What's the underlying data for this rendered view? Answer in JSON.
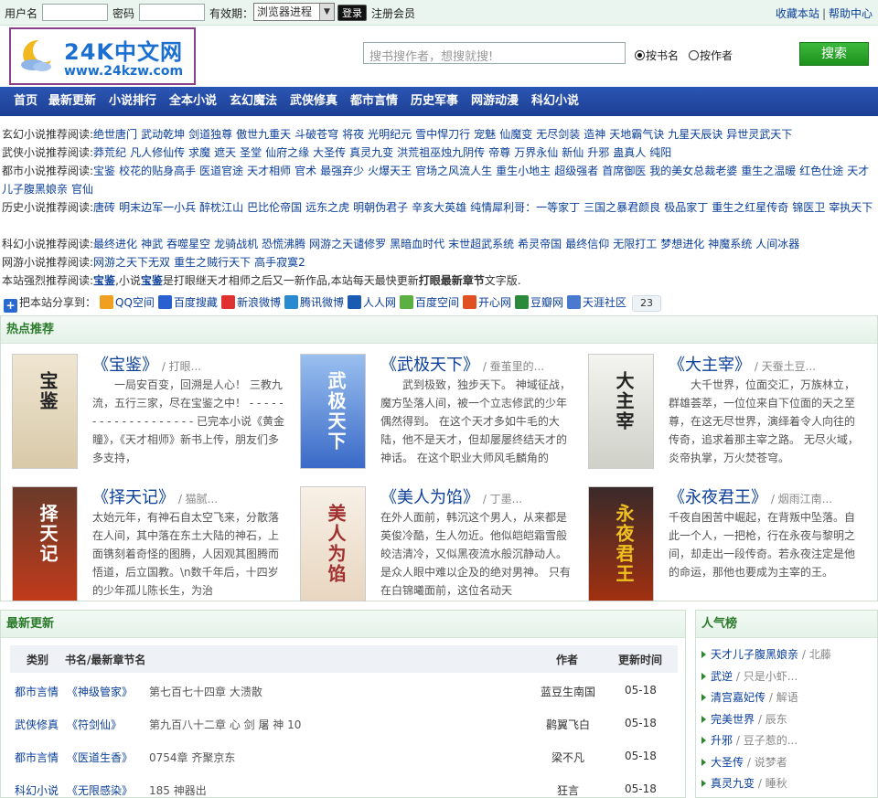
{
  "topbar": {
    "username_label": "用户名",
    "password_label": "密码",
    "validity_label": "有效期：",
    "validity_value": "浏览器进程",
    "login_label": "登录",
    "register_label": "注册会员",
    "bookmark_label": "收藏本站",
    "separator": "|",
    "help_label": "帮助中心"
  },
  "header": {
    "logo_title": "24K中文网",
    "logo_url": "www.24kzw.com",
    "search_placeholder": "搜书搜作者，想搜就搜!",
    "radio_title": "按书名",
    "radio_author": "按作者",
    "search_button": "搜索"
  },
  "nav": [
    "首页",
    "最新更新",
    "小说排行",
    "全本小说",
    "玄幻魔法",
    "武侠修真",
    "都市言情",
    "历史军事",
    "网游动漫",
    "科幻小说"
  ],
  "reco": {
    "rows": [
      {
        "cat": "玄幻小说推荐阅读:",
        "items": [
          "绝世唐门",
          "武动乾坤",
          "剑道独尊",
          "傲世九重天",
          "斗破苍穹",
          "将夜",
          "光明纪元",
          "雪中悍刀行",
          "宠魅",
          "仙魔变",
          "无尽剑装",
          "造神",
          "天地霸气诀",
          "九星天辰诀",
          "异世灵武天下"
        ]
      },
      {
        "cat": "武侠小说推荐阅读:",
        "items": [
          "莽荒纪",
          "凡人修仙传",
          "求魔",
          "遮天",
          "圣堂",
          "仙府之缘",
          "大圣传",
          "真灵九变",
          "洪荒祖巫烛九阴传",
          "帝尊",
          "万界永仙",
          "新仙",
          "升邪",
          "蛊真人",
          "纯阳"
        ]
      },
      {
        "cat": "都市小说推荐阅读:",
        "items": [
          "宝鉴",
          "校花的贴身高手",
          "医道官途",
          "天才相师",
          "官术",
          "最强弃少",
          "火爆天王",
          "官场之风流人生",
          "重生小地主",
          "超级强者",
          "首席御医",
          "我的美女总裁老婆",
          "重生之温暖",
          "红色仕途",
          "天才儿子腹黑娘亲",
          "官仙"
        ]
      },
      {
        "cat": "历史小说推荐阅读:",
        "items": [
          "唐砖",
          "明末边军一小兵",
          "醉枕江山",
          "巴比伦帝国",
          "远东之虎",
          "明朝伪君子",
          "辛亥大英雄",
          "纯情犀利哥：一等家丁",
          "三国之暴君颜良",
          "极品家丁",
          "重生之红星传奇",
          "锦医卫",
          "宰执天下"
        ]
      },
      {
        "cat": "",
        "items": []
      },
      {
        "cat": "科幻小说推荐阅读:",
        "items": [
          "最终进化",
          "神武",
          "吞噬星空",
          "龙骑战机",
          "恐慌沸腾",
          "网游之天谴修罗",
          "黑暗血时代",
          "末世超武系统",
          "希灵帝国",
          "最终信仰",
          "无限打工",
          "梦想进化",
          "神魔系统",
          "人间冰器"
        ]
      },
      {
        "cat": "网游小说推荐阅读:",
        "items": [
          "网游之天下无双",
          "重生之贼行天下",
          "高手寂寞2"
        ]
      }
    ],
    "strong_prefix": "本站强烈推荐阅读:",
    "strong_book": "宝鉴",
    "strong_mid1": ",小说",
    "strong_book2": "宝鉴",
    "strong_mid2": "是打眼继天才相师之后又一新作品,本站每天最快更新",
    "strong_bold": "打眼最新章节",
    "strong_tail": "文字版."
  },
  "share": {
    "label": "把本站分享到：",
    "targets": [
      {
        "name": "QQ空间",
        "color": "#f0a020"
      },
      {
        "name": "百度搜藏",
        "color": "#2a5fd0"
      },
      {
        "name": "新浪微博",
        "color": "#e03030"
      },
      {
        "name": "腾讯微博",
        "color": "#2a8ad0"
      },
      {
        "name": "人人网",
        "color": "#1a5ab0"
      },
      {
        "name": "百度空间",
        "color": "#5ab040"
      },
      {
        "name": "开心网",
        "color": "#e05020"
      },
      {
        "name": "豆瓣网",
        "color": "#2a8a3a"
      },
      {
        "name": "天涯社区",
        "color": "#4a7ad0"
      }
    ],
    "count": "23"
  },
  "hot": {
    "title": "热点推荐",
    "books": [
      {
        "title": "《宝鉴》",
        "author": " / 打眼...",
        "desc": "　　一局安百变，回溯是人心！ 三教九流，五行三家，尽在宝鉴之中！ - - - - - - - - - - - - - - - - - - - 已完本小说《黄金瞳》，《天才相师》新书上传，朋友们多多支持，",
        "cover_text": "宝鉴"
      },
      {
        "title": "《武极天下》",
        "author": " / 蚕茧里的...",
        "desc": "　　武到极致，独步天下。 神域征战，魔方坠落人间，被一个立志修武的少年偶然得到。 在这个天才多如牛毛的大陆，他不是天才，但却屡屡终结天才的神话。 在这个职业大师风毛麟角的",
        "cover_text": "武极天下"
      },
      {
        "title": "《大主宰》",
        "author": " / 天蚕土豆...",
        "desc": "　　大千世界，位面交汇，万族林立，群雄荟萃，一位位来自下位面的天之至尊，在这无尽世界，演绎着令人向往的传奇，追求着那主宰之路。 无尽火域，炎帝执掌，万火焚苍穹。",
        "cover_text": "大主宰"
      },
      {
        "title": "《择天记》",
        "author": " / 猫腻...",
        "desc": "太始元年，有神石自太空飞来，分散落在人间，其中落在东土大陆的神石，上面镌刻着奇怪的图腾，人因观其图腾而悟道，后立国教。\\n数千年后，十四岁的少年孤儿陈长生，为治",
        "cover_text": "择天记"
      },
      {
        "title": "《美人为馅》",
        "author": " / 丁墨...",
        "desc": "在外人面前，韩沉这个男人，从来都是英俊冷酷，生人勿近。他似皑皑霜雪般皎洁清冷，又似黑夜流水般沉静动人。是众人眼中难以企及的绝对男神。 只有在白锦曦面前，这位名动天",
        "cover_text": "美人为馅"
      },
      {
        "title": "《永夜君王》",
        "author": " / 烟雨江南...",
        "desc": "千夜自困苦中崛起，在背叛中坠落。自此一个人，一把枪，行在永夜与黎明之间，却走出一段传奇。若永夜注定是他的命运，那他也要成为主宰的王。",
        "cover_text": "永夜君王"
      }
    ]
  },
  "latest": {
    "title": "最新更新",
    "headers": {
      "category": "类别",
      "book": "书名/最新章节名",
      "author": "作者",
      "time": "更新时间"
    },
    "rows": [
      {
        "category": "都市言情",
        "book": "《神级管家》",
        "chapter": "第七百七十四章  大溃散",
        "author": "蓝豆生南国",
        "time": "05-18"
      },
      {
        "category": "武侠修真",
        "book": "《符剑仙》",
        "chapter": "第九百八十二章    心 剑 屠 神     10",
        "author": "鹳翼飞白",
        "time": "05-18"
      },
      {
        "category": "都市言情",
        "book": "《医道生香》",
        "chapter": "0754章 齐聚京东",
        "author": "梁不凡",
        "time": "05-18"
      },
      {
        "category": "科幻小说",
        "book": "《无限感染》",
        "chapter": "185 神器出",
        "author": "狂言",
        "time": "05-18"
      }
    ]
  },
  "popular": {
    "title": "人气榜",
    "items": [
      {
        "name": "天才儿子腹黑娘亲",
        "author": " / 北藤"
      },
      {
        "name": "武逆",
        "author": " / 只是小虾..."
      },
      {
        "name": "清宫嘉妃传",
        "author": " / 解语"
      },
      {
        "name": "完美世界",
        "author": " / 辰东"
      },
      {
        "name": "升邪",
        "author": " / 豆子惹的..."
      },
      {
        "name": "大圣传",
        "author": " / 说梦者"
      },
      {
        "name": "真灵九变",
        "author": " / 睡秋"
      }
    ]
  }
}
